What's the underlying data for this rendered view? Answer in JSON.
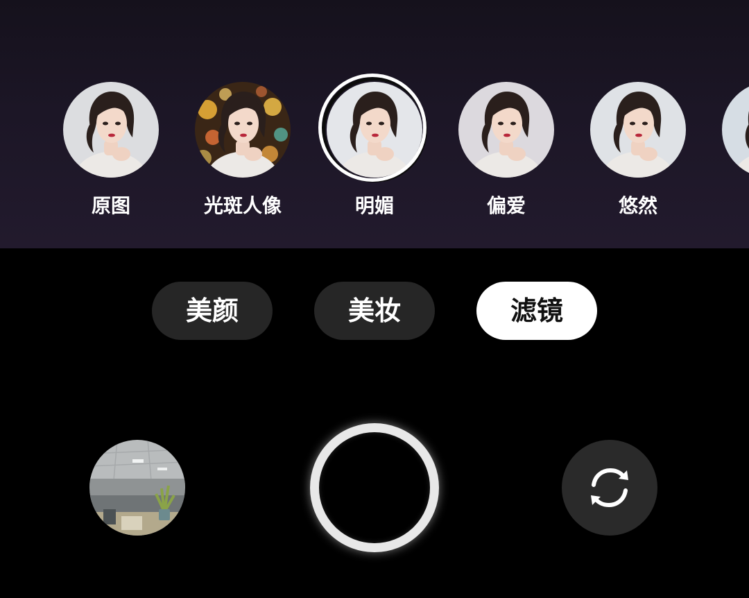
{
  "filters": {
    "items": [
      {
        "label": "原图"
      },
      {
        "label": "光斑人像"
      },
      {
        "label": "明媚"
      },
      {
        "label": "偏爱"
      },
      {
        "label": "悠然"
      }
    ],
    "selected_label": "明媚"
  },
  "mode_tabs": {
    "beauty_label": "美颜",
    "makeup_label": "美妆",
    "filter_label": "滤镜",
    "active": "滤镜"
  },
  "controls": {
    "gallery_icon": "gallery-thumbnail",
    "shutter_icon": "shutter-ring",
    "switch_icon": "camera-switch-icon"
  },
  "colors": {
    "background": "#000000",
    "strip_background": "#1c1626",
    "tab_background": "#262626",
    "tab_active_background": "#ffffff",
    "shutter_ring": "#e8e8e8"
  }
}
